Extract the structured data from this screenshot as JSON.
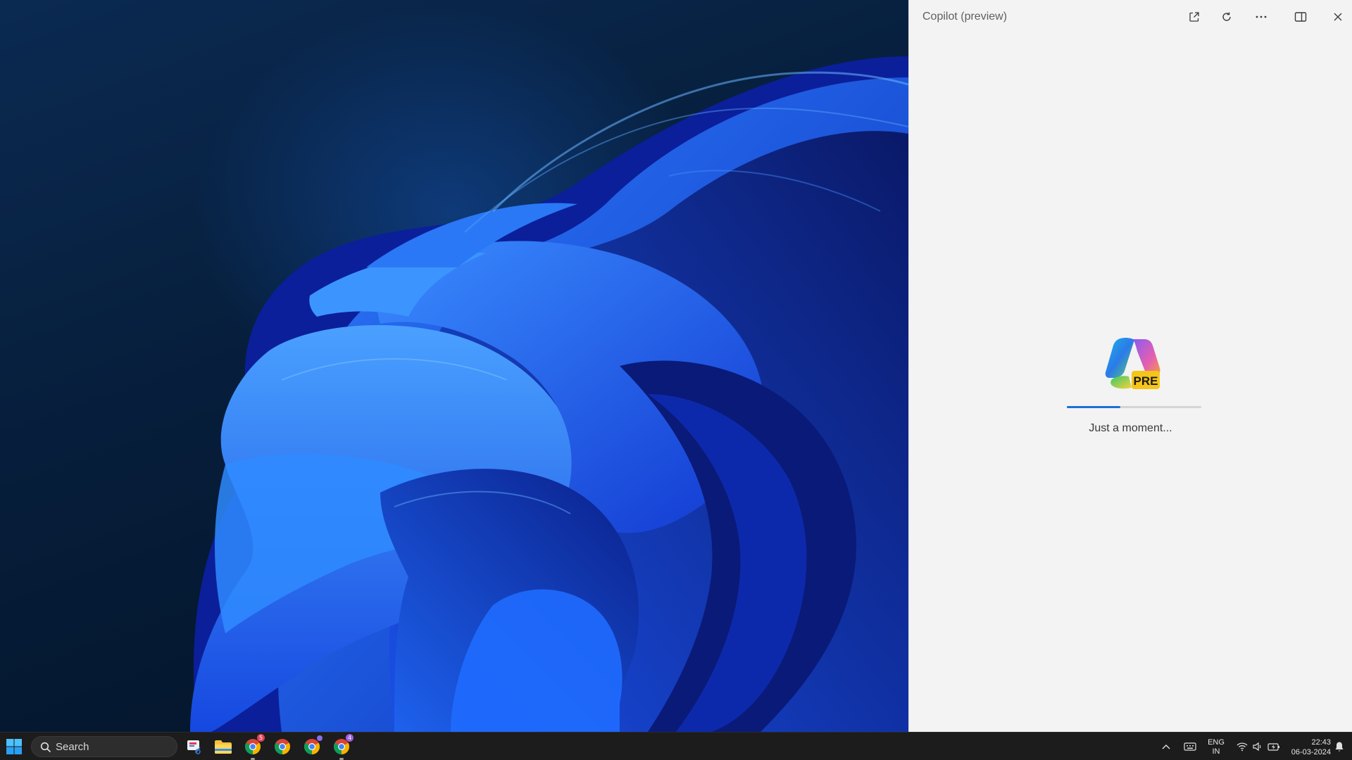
{
  "copilot": {
    "title": "Copilot (preview)",
    "logo_badge": "PRE",
    "loading_text": "Just a moment...",
    "progress": 0.4,
    "buttons": {
      "open_in_browser_icon": "external-link-icon",
      "refresh_icon": "refresh-icon",
      "more_icon": "more-options-icon",
      "dock_icon": "dock-side-icon",
      "close_icon": "close-icon"
    }
  },
  "taskbar": {
    "search_label": "Search",
    "apps": [
      {
        "name": "snipping-tool",
        "icon": "snipping-tool-icon"
      },
      {
        "name": "file-explorer",
        "icon": "folder-icon"
      },
      {
        "name": "chrome-profile-1",
        "icon": "chrome-icon",
        "badge": "5",
        "badge_color": "#e0455b"
      },
      {
        "name": "chrome-profile-2",
        "icon": "chrome-icon"
      },
      {
        "name": "chrome-profile-3",
        "icon": "chrome-icon"
      },
      {
        "name": "chrome-profile-4",
        "icon": "chrome-icon",
        "badge": "4",
        "badge_color": "#a05ee0"
      }
    ],
    "language": {
      "line1": "ENG",
      "line2": "IN"
    },
    "time": "22:43",
    "date": "06-03-2024"
  },
  "colors": {
    "accent": "#1d6fd6",
    "taskbar_bg": "#1c1c1c",
    "panel_bg": "#f3f3f3"
  }
}
